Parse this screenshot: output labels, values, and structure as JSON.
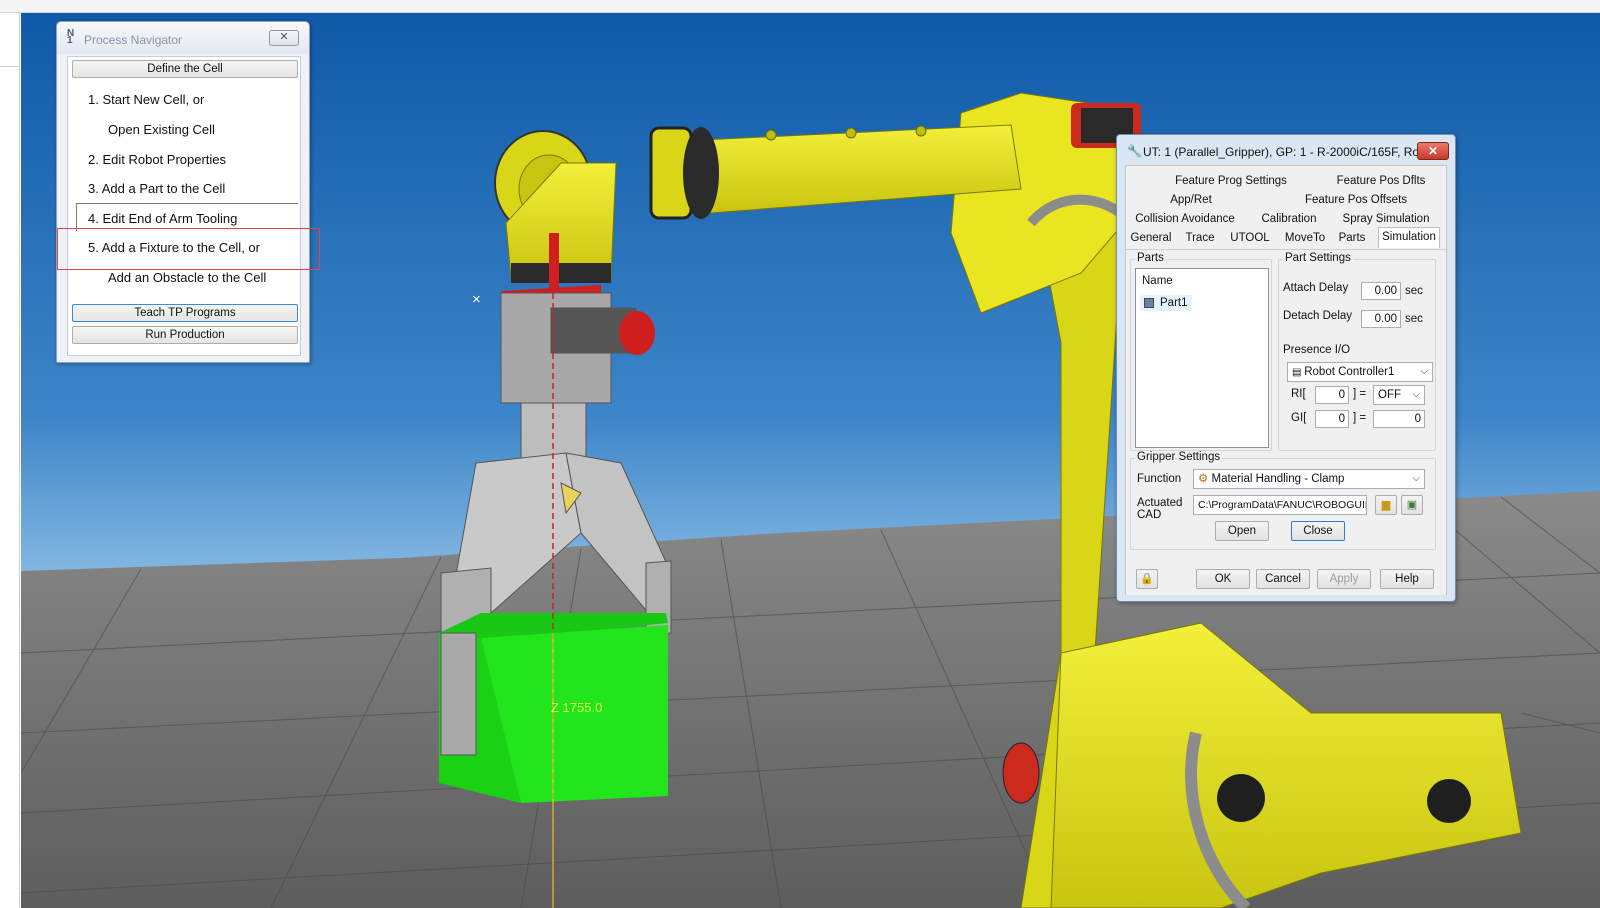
{
  "process_navigator": {
    "title": "Process Navigator",
    "close_glyph": "✕",
    "define_cell_button": "Define the Cell",
    "steps": [
      "1.  Start New Cell, or",
      "Open Existing Cell",
      "2.  Edit Robot Properties",
      "3.  Add a Part to the Cell",
      "4.  Edit End of Arm Tooling",
      "5.  Add a Fixture to the Cell, or",
      "Add an Obstacle to the Cell"
    ],
    "teach_button": "Teach TP Programs",
    "run_button": "Run Production"
  },
  "viewport": {
    "z_label": "Z 1755.0",
    "cursor_glyph": "×"
  },
  "ut_dialog": {
    "title": "UT: 1  (Parallel_Gripper), GP: 1 - R-2000iC/165F, Ro...",
    "close_glyph": "✕",
    "tabs_row1": [
      "Feature Prog Settings",
      "Feature Pos Dflts"
    ],
    "tabs_row2": [
      "App/Ret",
      "Feature Pos Offsets"
    ],
    "tabs_row3": [
      "Collision Avoidance",
      "Calibration",
      "Spray Simulation"
    ],
    "tabs_row4": [
      "General",
      "Trace",
      "UTOOL",
      "MoveTo",
      "Parts",
      "Simulation"
    ],
    "parts": {
      "group_label": "Parts",
      "column_header": "Name",
      "items": [
        "Part1"
      ]
    },
    "part_settings": {
      "group_label": "Part Settings",
      "attach_delay_label": "Attach Delay",
      "attach_delay_value": "0.00",
      "detach_delay_label": "Detach Delay",
      "detach_delay_value": "0.00",
      "unit": "sec",
      "presence_io_label": "Presence I/O",
      "controller": "Robot Controller1",
      "ri_label": "RI[",
      "ri_value": "0",
      "ri_eq": "] =",
      "ri_state": "OFF",
      "gi_label": "GI[",
      "gi_value": "0",
      "gi_eq": "] =",
      "gi_state": "0"
    },
    "gripper_settings": {
      "group_label": "Gripper Settings",
      "function_label": "Function",
      "function_value": "Material Handling - Clamp",
      "actuated_label_1": "Actuated",
      "actuated_label_2": "CAD",
      "actuated_path": "C:\\ProgramData\\FANUC\\ROBOGUID",
      "open_button": "Open",
      "close_button": "Close"
    },
    "footer": {
      "ok": "OK",
      "cancel": "Cancel",
      "apply": "Apply",
      "help": "Help"
    }
  },
  "colors": {
    "sky_top": "#1762b0",
    "sky_bottom": "#9cc9ea",
    "floor": "#6e6e6e",
    "robot_yellow": "#e6e31a",
    "part_green": "#22e51c",
    "highlight_red": "#e0444a"
  }
}
